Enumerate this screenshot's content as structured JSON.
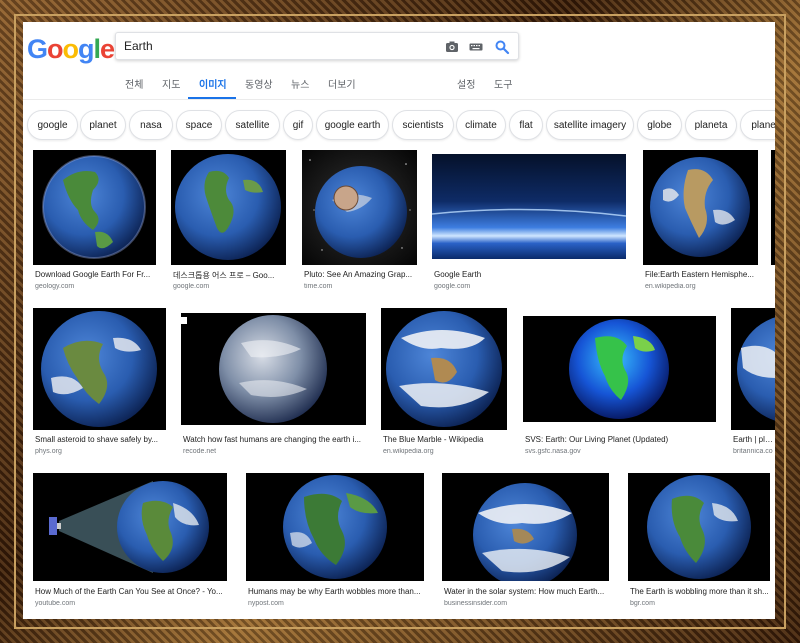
{
  "search": {
    "query": "Earth"
  },
  "logo": {
    "letters": [
      "G",
      "o",
      "o",
      "g",
      "l",
      "e"
    ],
    "colors": [
      "#4285f4",
      "#ea4335",
      "#fbbc05",
      "#4285f4",
      "#34a853",
      "#ea4335"
    ]
  },
  "nav": {
    "items": [
      "전체",
      "지도",
      "이미지",
      "동영상",
      "뉴스",
      "더보기"
    ],
    "active_index": 2,
    "settings": "설정",
    "tools": "도구"
  },
  "chips": [
    "google",
    "planet",
    "nasa",
    "space",
    "satellite",
    "gif",
    "google earth",
    "scientists",
    "climate",
    "flat",
    "satellite imagery",
    "globe",
    "planeta",
    "planet"
  ],
  "results": [
    {
      "caption": "Download Google Earth For Fr...",
      "source": "geology.com"
    },
    {
      "caption": "데스크톱용 어스 프로 – Goo...",
      "source": "google.com"
    },
    {
      "caption": "Pluto: See An Amazing Grap...",
      "source": "time.com"
    },
    {
      "caption": "Google Earth",
      "source": "google.com"
    },
    {
      "caption": "File:Earth Eastern Hemisphe...",
      "source": "en.wikipedia.org"
    },
    {
      "caption": "",
      "source": ""
    },
    {
      "caption": "Small asteroid to shave safely by...",
      "source": "phys.org"
    },
    {
      "caption": "Watch how fast humans are changing the earth i...",
      "source": "recode.net"
    },
    {
      "caption": "The Blue Marble - Wikipedia",
      "source": "en.wikipedia.org"
    },
    {
      "caption": "SVS: Earth: Our Living Planet (Updated)",
      "source": "svs.gsfc.nasa.gov"
    },
    {
      "caption": "Earth | plane",
      "source": "britannica.co"
    },
    {
      "caption": "How Much of the Earth Can You See at Once? - Yo...",
      "source": "youtube.com"
    },
    {
      "caption": "Humans may be why Earth wobbles more than...",
      "source": "nypost.com"
    },
    {
      "caption": "Water in the solar system: How much Earth...",
      "source": "businessinsider.com"
    },
    {
      "caption": "The Earth is wobbling more than it sh...",
      "source": "bgr.com"
    }
  ],
  "colors": {
    "accent": "#1a73e8",
    "ocean": "#2a5db0",
    "land": "#3f7a3a"
  }
}
